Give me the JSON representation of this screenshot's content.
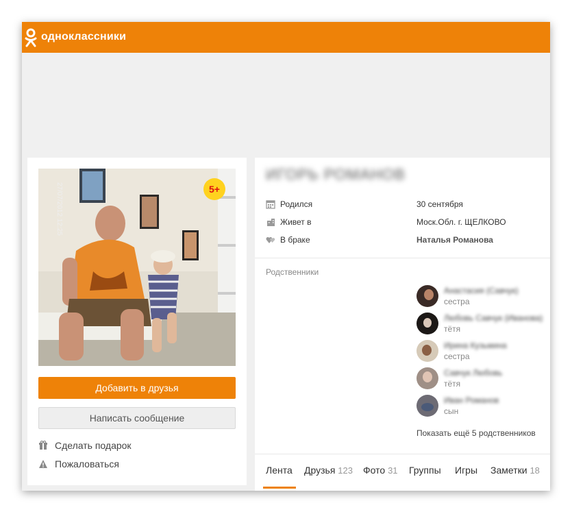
{
  "header": {
    "brand": "одноклассники",
    "logo_icon": "ok-logo-icon",
    "color": "#ee8208"
  },
  "profile": {
    "name": "ИГОРЬ РОМАНОВ",
    "age_badge": "5+",
    "add_friend_label": "Добавить в друзья",
    "write_message_label": "Написать сообщение",
    "gift_label": "Сделать подарок",
    "report_label": "Пожаловаться"
  },
  "info": [
    {
      "icon": "calendar-icon",
      "key": "Родился",
      "value": "30 сентября"
    },
    {
      "icon": "house-icon",
      "key": "Живет в",
      "value": "Моск.Обл. г. ЩЕЛКОВО"
    },
    {
      "icon": "hearts-icon",
      "key": "В браке",
      "value": "Наталья Романова"
    }
  ],
  "relatives": {
    "title": "Родственники",
    "items": [
      {
        "name": "Анастасия (Савчук)",
        "role": "сестра"
      },
      {
        "name": "Любовь Савчук (Иванова)",
        "role": "тётя"
      },
      {
        "name": "Ирина Кузьмина",
        "role": "сестра"
      },
      {
        "name": "Савчук Любовь",
        "role": "тётя"
      },
      {
        "name": "Иван Романов",
        "role": "сын"
      }
    ],
    "more_label": "Показать ещё 5 родственников"
  },
  "tabs": [
    {
      "label": "Лента",
      "count": ""
    },
    {
      "label": "Друзья",
      "count": "123"
    },
    {
      "label": "Фото",
      "count": "31"
    },
    {
      "label": "Группы",
      "count": ""
    },
    {
      "label": "Игры",
      "count": ""
    },
    {
      "label": "Заметки",
      "count": "18"
    }
  ]
}
